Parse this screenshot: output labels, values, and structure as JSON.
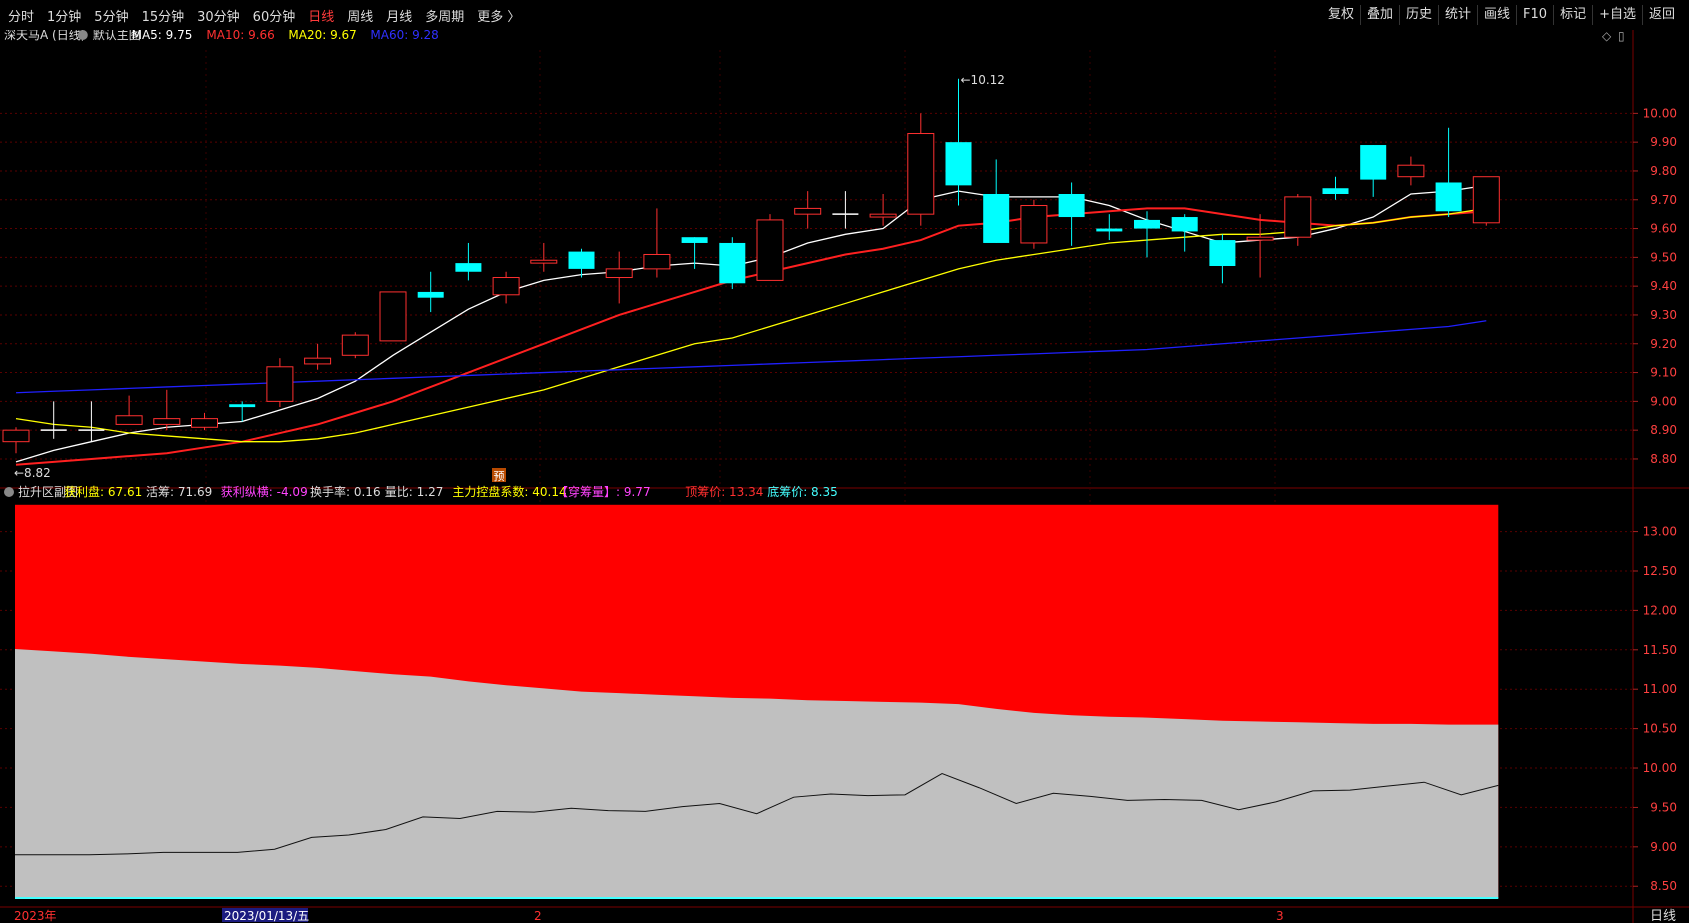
{
  "toolbar": {
    "left_items": [
      "分时",
      "1分钟",
      "5分钟",
      "15分钟",
      "30分钟",
      "60分钟",
      "日线",
      "周线",
      "月线",
      "多周期",
      "更多 〉"
    ],
    "active_item": "日线",
    "right_items": [
      "复权",
      "叠加",
      "历史",
      "统计",
      "画线",
      "F10",
      "标记",
      "+自选",
      "返回"
    ]
  },
  "main_header": {
    "stock": "深天马A (日线)",
    "template": "默认主图",
    "ma5": "MA5: 9.75",
    "ma10": "MA10: 9.66",
    "ma20": "MA20: 9.67",
    "ma60": "MA60: 9.28"
  },
  "sub_header": {
    "name": "拉升区副图",
    "items": [
      {
        "text": "获利盘: 67.61",
        "color": "#ffff00"
      },
      {
        "text": "活筹: 71.69",
        "color": "#dddddd"
      },
      {
        "text": "获利纵横: -4.09",
        "color": "#ff44ff"
      },
      {
        "text": "换手率: 0.16",
        "color": "#dddddd"
      },
      {
        "text": "量比: 1.27",
        "color": "#dddddd"
      },
      {
        "text": "主力控盘系数: 40.14",
        "color": "#ffff00"
      },
      {
        "text": "【穿筹量】: 9.77",
        "color": "#ff44ff"
      },
      {
        "text": "顶筹价: 13.34",
        "color": "#ff3030"
      },
      {
        "text": "底筹价: 8.35",
        "color": "#44ffff"
      }
    ]
  },
  "bottom_axis": {
    "labels": [
      "2023年",
      "2023/01/13/五",
      "2",
      "3"
    ],
    "period_label": "日线"
  },
  "chart_data": {
    "type": "candlestick",
    "main": {
      "ylim": [
        8.72,
        10.22
      ],
      "y_ticks": [
        "8.80",
        "8.90",
        "9.00",
        "9.10",
        "9.20",
        "9.30",
        "9.40",
        "9.50",
        "9.60",
        "9.70",
        "9.80",
        "9.90",
        "10.00"
      ],
      "high_label": "10.12",
      "low_label": "8.82",
      "marker_label": "预",
      "candles": [
        {
          "o": 8.86,
          "c": 8.9,
          "h": 8.91,
          "l": 8.82
        },
        {
          "o": 8.9,
          "c": 8.9,
          "h": 9.0,
          "l": 8.87
        },
        {
          "o": 8.9,
          "c": 8.9,
          "h": 9.0,
          "l": 8.86
        },
        {
          "o": 8.92,
          "c": 8.95,
          "h": 9.02,
          "l": 8.92
        },
        {
          "o": 8.92,
          "c": 8.94,
          "h": 9.04,
          "l": 8.9
        },
        {
          "o": 8.91,
          "c": 8.94,
          "h": 8.96,
          "l": 8.9
        },
        {
          "o": 8.99,
          "c": 8.98,
          "h": 9.0,
          "l": 8.93
        },
        {
          "o": 9.0,
          "c": 9.12,
          "h": 9.15,
          "l": 8.98
        },
        {
          "o": 9.13,
          "c": 9.15,
          "h": 9.2,
          "l": 9.11
        },
        {
          "o": 9.16,
          "c": 9.23,
          "h": 9.24,
          "l": 9.15
        },
        {
          "o": 9.21,
          "c": 9.38,
          "h": 9.38,
          "l": 9.21
        },
        {
          "o": 9.38,
          "c": 9.36,
          "h": 9.45,
          "l": 9.31
        },
        {
          "o": 9.48,
          "c": 9.45,
          "h": 9.55,
          "l": 9.42
        },
        {
          "o": 9.37,
          "c": 9.43,
          "h": 9.45,
          "l": 9.34
        },
        {
          "o": 9.48,
          "c": 9.49,
          "h": 9.55,
          "l": 9.45
        },
        {
          "o": 9.52,
          "c": 9.46,
          "h": 9.53,
          "l": 9.43
        },
        {
          "o": 9.43,
          "c": 9.46,
          "h": 9.52,
          "l": 9.34
        },
        {
          "o": 9.46,
          "c": 9.51,
          "h": 9.67,
          "l": 9.43
        },
        {
          "o": 9.57,
          "c": 9.55,
          "h": 9.57,
          "l": 9.46
        },
        {
          "o": 9.55,
          "c": 9.41,
          "h": 9.57,
          "l": 9.39
        },
        {
          "o": 9.42,
          "c": 9.63,
          "h": 9.65,
          "l": 9.42
        },
        {
          "o": 9.65,
          "c": 9.67,
          "h": 9.73,
          "l": 9.6
        },
        {
          "o": 9.65,
          "c": 9.65,
          "h": 9.73,
          "l": 9.6
        },
        {
          "o": 9.64,
          "c": 9.65,
          "h": 9.72,
          "l": 9.61
        },
        {
          "o": 9.65,
          "c": 9.93,
          "h": 10.0,
          "l": 9.61
        },
        {
          "o": 9.9,
          "c": 9.75,
          "h": 10.12,
          "l": 9.68
        },
        {
          "o": 9.72,
          "c": 9.55,
          "h": 9.84,
          "l": 9.55
        },
        {
          "o": 9.55,
          "c": 9.68,
          "h": 9.7,
          "l": 9.53
        },
        {
          "o": 9.72,
          "c": 9.64,
          "h": 9.76,
          "l": 9.54
        },
        {
          "o": 9.6,
          "c": 9.59,
          "h": 9.65,
          "l": 9.56
        },
        {
          "o": 9.63,
          "c": 9.6,
          "h": 9.66,
          "l": 9.5
        },
        {
          "o": 9.64,
          "c": 9.59,
          "h": 9.65,
          "l": 9.52
        },
        {
          "o": 9.56,
          "c": 9.47,
          "h": 9.58,
          "l": 9.41
        },
        {
          "o": 9.56,
          "c": 9.57,
          "h": 9.65,
          "l": 9.43
        },
        {
          "o": 9.57,
          "c": 9.71,
          "h": 9.72,
          "l": 9.54
        },
        {
          "o": 9.74,
          "c": 9.72,
          "h": 9.78,
          "l": 9.7
        },
        {
          "o": 9.89,
          "c": 9.77,
          "h": 9.89,
          "l": 9.71
        },
        {
          "o": 9.78,
          "c": 9.82,
          "h": 9.85,
          "l": 9.75
        },
        {
          "o": 9.76,
          "c": 9.66,
          "h": 9.95,
          "l": 9.64
        },
        {
          "o": 9.62,
          "c": 9.78,
          "h": 9.78,
          "l": 9.61
        }
      ],
      "ma_lines": [
        {
          "name": "MA5",
          "color": "#ffffff",
          "values": [
            8.79,
            8.83,
            8.86,
            8.89,
            8.91,
            8.92,
            8.93,
            8.97,
            9.01,
            9.07,
            9.16,
            9.24,
            9.32,
            9.38,
            9.42,
            9.44,
            9.45,
            9.47,
            9.48,
            9.47,
            9.5,
            9.55,
            9.58,
            9.6,
            9.7,
            9.73,
            9.71,
            9.71,
            9.71,
            9.68,
            9.63,
            9.59,
            9.55,
            9.56,
            9.57,
            9.6,
            9.64,
            9.72,
            9.73,
            9.75
          ]
        },
        {
          "name": "MA10",
          "color": "#ff2020",
          "values": [
            8.78,
            8.79,
            8.8,
            8.81,
            8.82,
            8.84,
            8.86,
            8.89,
            8.92,
            8.96,
            9.0,
            9.05,
            9.1,
            9.15,
            9.2,
            9.25,
            9.3,
            9.34,
            9.38,
            9.42,
            9.45,
            9.48,
            9.51,
            9.53,
            9.56,
            9.61,
            9.62,
            9.64,
            9.65,
            9.66,
            9.67,
            9.67,
            9.65,
            9.63,
            9.62,
            9.61,
            9.62,
            9.64,
            9.65,
            9.66
          ]
        },
        {
          "name": "MA20",
          "color": "#ffff00",
          "values": [
            8.94,
            8.92,
            8.91,
            8.89,
            8.88,
            8.87,
            8.86,
            8.86,
            8.87,
            8.89,
            8.92,
            8.95,
            8.98,
            9.01,
            9.04,
            9.08,
            9.12,
            9.16,
            9.2,
            9.22,
            9.26,
            9.3,
            9.34,
            9.38,
            9.42,
            9.46,
            9.49,
            9.51,
            9.53,
            9.55,
            9.56,
            9.57,
            9.58,
            9.58,
            9.59,
            9.61,
            9.62,
            9.64,
            9.65,
            9.67
          ]
        },
        {
          "name": "MA60",
          "color": "#2020ff",
          "values": [
            9.03,
            9.035,
            9.04,
            9.045,
            9.05,
            9.055,
            9.06,
            9.065,
            9.07,
            9.075,
            9.08,
            9.085,
            9.09,
            9.095,
            9.1,
            9.105,
            9.11,
            9.115,
            9.12,
            9.125,
            9.13,
            9.135,
            9.14,
            9.145,
            9.15,
            9.155,
            9.16,
            9.165,
            9.17,
            9.175,
            9.18,
            9.19,
            9.2,
            9.21,
            9.22,
            9.23,
            9.24,
            9.25,
            9.26,
            9.28
          ]
        }
      ]
    },
    "sub": {
      "ylim": [
        8.3,
        13.35
      ],
      "y_ticks": [
        "8.50",
        "9.00",
        "9.50",
        "10.00",
        "10.50",
        "11.00",
        "11.50",
        "12.00",
        "12.50",
        "13.00"
      ],
      "top_price": 13.34,
      "bottom_price": 8.35,
      "gray_upper": [
        11.51,
        11.48,
        11.45,
        11.41,
        11.38,
        11.35,
        11.32,
        11.3,
        11.27,
        11.23,
        11.19,
        11.16,
        11.1,
        11.05,
        11.01,
        10.97,
        10.95,
        10.93,
        10.91,
        10.89,
        10.88,
        10.86,
        10.85,
        10.84,
        10.83,
        10.81,
        10.75,
        10.7,
        10.67,
        10.65,
        10.64,
        10.62,
        10.6,
        10.59,
        10.58,
        10.57,
        10.56,
        10.56,
        10.55,
        10.55
      ],
      "line_values": [
        8.9,
        8.9,
        8.9,
        8.91,
        8.93,
        8.93,
        8.93,
        8.97,
        9.12,
        9.15,
        9.22,
        9.38,
        9.36,
        9.45,
        9.44,
        9.49,
        9.46,
        9.45,
        9.51,
        9.55,
        9.42,
        9.63,
        9.67,
        9.65,
        9.66,
        9.93,
        9.75,
        9.55,
        9.68,
        9.64,
        9.59,
        9.6,
        9.59,
        9.47,
        9.57,
        9.71,
        9.72,
        9.77,
        9.82,
        9.66,
        9.78
      ]
    }
  }
}
